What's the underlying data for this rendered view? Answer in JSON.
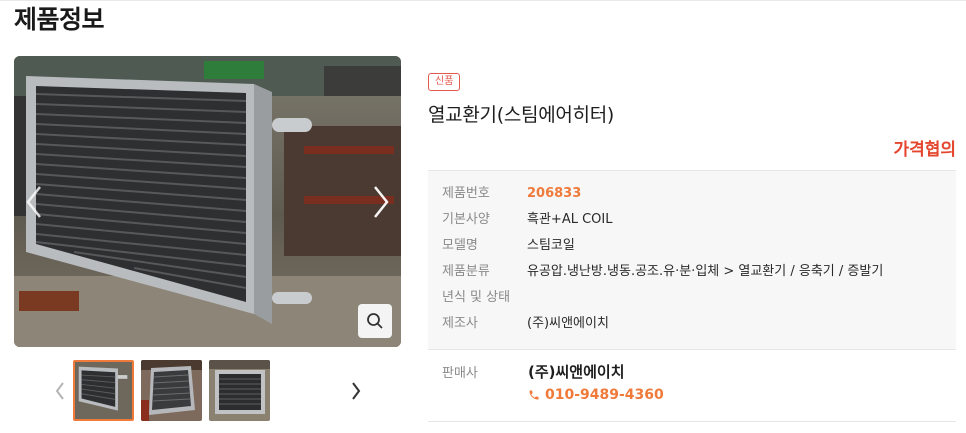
{
  "page": {
    "title": "제품정보"
  },
  "gallery": {
    "thumbnails": [
      {
        "name": "thumbnail-1",
        "active": true
      },
      {
        "name": "thumbnail-2",
        "active": false
      },
      {
        "name": "thumbnail-3",
        "active": false
      }
    ]
  },
  "product": {
    "badge": "신품",
    "name": "열교환기(스팀에어히터)",
    "price": "가격협의",
    "info": [
      {
        "label": "제품번호",
        "value": "206833",
        "highlight": true
      },
      {
        "label": "기본사양",
        "value": "흑관+AL COIL"
      },
      {
        "label": "모델명",
        "value": "스팀코일"
      },
      {
        "label": "제품분류",
        "value": "유공압.냉난방.냉동.공조.유·분·입체 > 열교환기 / 응축기 / 증발기"
      },
      {
        "label": "년식 및 상태",
        "value": ""
      },
      {
        "label": "제조사",
        "value": "(주)씨앤에이치"
      }
    ]
  },
  "seller": {
    "label": "판매사",
    "name": "(주)씨앤에이치",
    "phone": "010-9489-4360"
  },
  "colors": {
    "accent": "#f07a3a",
    "price": "#e5462f",
    "badge": "#e25b4e"
  }
}
